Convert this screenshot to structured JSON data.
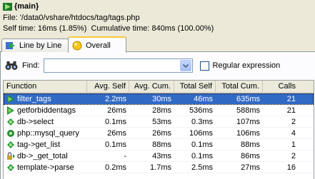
{
  "header": {
    "title": "{main}",
    "file_line": "File: '/data0/vshare/htdocs/tag/tags.php",
    "time_line": "Self time: 16ms (1.85%)  Cumulative time: 840ms (100.00%)"
  },
  "tabs": [
    {
      "label": "Line by Line"
    },
    {
      "label": "Overall"
    }
  ],
  "find": {
    "label": "Find:",
    "value": "",
    "regex_label": "Regular expression"
  },
  "table": {
    "headers": [
      "Function",
      "Avg. Self",
      "Avg. Cum.",
      "Total Self",
      "Total Cum.",
      "Calls"
    ],
    "rows": [
      {
        "icon": "play-icon",
        "name": "filter_tags",
        "avg_self": "2.2ms",
        "avg_cum": "30ms",
        "total_self": "46ms",
        "total_cum": "635ms",
        "calls": "21",
        "selected": true
      },
      {
        "icon": "play-icon",
        "name": "getforbiddentags",
        "avg_self": "26ms",
        "avg_cum": "28ms",
        "total_self": "536ms",
        "total_cum": "588ms",
        "calls": "21"
      },
      {
        "icon": "method-icon",
        "name": "db->select",
        "avg_self": "0.1ms",
        "avg_cum": "53ms",
        "total_self": "0.3ms",
        "total_cum": "107ms",
        "calls": "2"
      },
      {
        "icon": "builtin-icon",
        "name": "php::mysql_query",
        "avg_self": "26ms",
        "avg_cum": "26ms",
        "total_self": "106ms",
        "total_cum": "106ms",
        "calls": "4"
      },
      {
        "icon": "method-icon",
        "name": "tag->get_list",
        "avg_self": "0.1ms",
        "avg_cum": "88ms",
        "total_self": "0.1ms",
        "total_cum": "88ms",
        "calls": "1"
      },
      {
        "icon": "lock-method-icon",
        "name": "db->_get_total",
        "avg_self": "-",
        "avg_cum": "43ms",
        "total_self": "0.1ms",
        "total_cum": "86ms",
        "calls": "2"
      },
      {
        "icon": "method-icon",
        "name": "template->parse",
        "avg_self": "0.2ms",
        "avg_cum": "1.7ms",
        "total_self": "2.5ms",
        "total_cum": "27ms",
        "calls": "16"
      }
    ]
  }
}
